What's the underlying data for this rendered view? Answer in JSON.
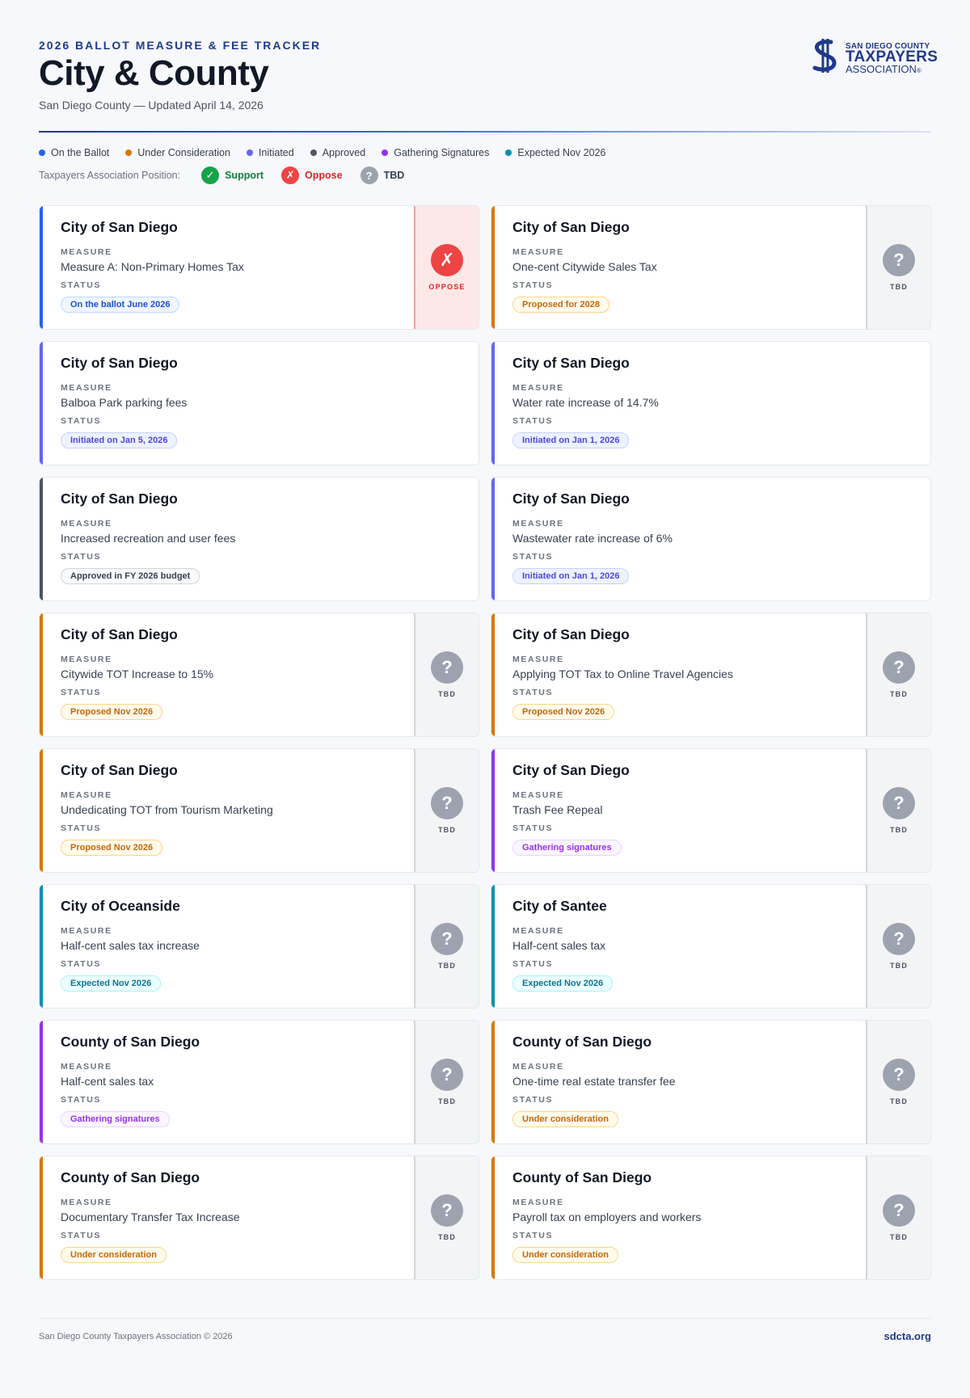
{
  "header": {
    "kicker": "2026 BALLOT MEASURE & FEE TRACKER",
    "title": "City & County",
    "subtitle": "San Diego County — Updated April 14, 2026"
  },
  "logo": {
    "line1": "SAN DIEGO COUNTY",
    "line2": "TAXPAYERS",
    "line3": "ASSOCIATION",
    "reg": "®"
  },
  "legend": [
    {
      "label": "On the Ballot",
      "color": "#2563eb"
    },
    {
      "label": "Under Consideration",
      "color": "#d97706"
    },
    {
      "label": "Initiated",
      "color": "#6366f1"
    },
    {
      "label": "Approved",
      "color": "#4b5563"
    },
    {
      "label": "Gathering Signatures",
      "color": "#9333ea"
    },
    {
      "label": "Expected Nov 2026",
      "color": "#0891b2"
    }
  ],
  "positions": {
    "label": "Taxpayers Association Position:",
    "items": [
      {
        "label": "Support",
        "glyph": "✓",
        "color": "#16a34a",
        "text_color": "#15803d",
        "icon": "check-icon"
      },
      {
        "label": "Oppose",
        "glyph": "✗",
        "color": "#ef4444",
        "text_color": "#dc2626",
        "icon": "x-icon"
      },
      {
        "label": "TBD",
        "glyph": "?",
        "color": "#9ca3af",
        "text_color": "#374151",
        "icon": "question-icon"
      }
    ]
  },
  "labels": {
    "measure": "MEASURE",
    "status": "STATUS"
  },
  "cards": [
    {
      "jurisdiction": "City of San Diego",
      "measure": "Measure A: Non-Primary Homes Tax",
      "status": "On the ballot June 2026",
      "category": "ballot",
      "position": "oppose",
      "position_label": "OPPOSE"
    },
    {
      "jurisdiction": "City of San Diego",
      "measure": "One-cent Citywide Sales Tax",
      "status": "Proposed for 2028",
      "category": "consideration",
      "position": "tbd",
      "position_label": "TBD"
    },
    {
      "jurisdiction": "City of San Diego",
      "measure": "Balboa Park parking fees",
      "status": "Initiated on Jan 5, 2026",
      "category": "initiated",
      "position": "none",
      "position_label": ""
    },
    {
      "jurisdiction": "City of San Diego",
      "measure": "Water rate increase of 14.7%",
      "status": "Initiated on Jan 1, 2026",
      "category": "initiated",
      "position": "none",
      "position_label": ""
    },
    {
      "jurisdiction": "City of San Diego",
      "measure": "Increased recreation and user fees",
      "status": "Approved in FY 2026 budget",
      "category": "approved",
      "position": "none",
      "position_label": ""
    },
    {
      "jurisdiction": "City of San Diego",
      "measure": "Wastewater rate increase of 6%",
      "status": "Initiated on Jan 1, 2026",
      "category": "initiated",
      "position": "none",
      "position_label": ""
    },
    {
      "jurisdiction": "City of San Diego",
      "measure": "Citywide TOT Increase to 15%",
      "status": "Proposed Nov 2026",
      "category": "consideration",
      "position": "tbd",
      "position_label": "TBD"
    },
    {
      "jurisdiction": "City of San Diego",
      "measure": "Applying TOT Tax to Online Travel Agencies",
      "status": "Proposed Nov 2026",
      "category": "consideration",
      "position": "tbd",
      "position_label": "TBD"
    },
    {
      "jurisdiction": "City of San Diego",
      "measure": "Undedicating TOT from Tourism Marketing",
      "status": "Proposed Nov 2026",
      "category": "consideration",
      "position": "tbd",
      "position_label": "TBD"
    },
    {
      "jurisdiction": "City of San Diego",
      "measure": "Trash Fee Repeal",
      "status": "Gathering signatures",
      "category": "signatures",
      "position": "tbd",
      "position_label": "TBD"
    },
    {
      "jurisdiction": "City of Oceanside",
      "measure": "Half-cent sales tax increase",
      "status": "Expected Nov 2026",
      "category": "expected",
      "position": "tbd",
      "position_label": "TBD"
    },
    {
      "jurisdiction": "City of Santee",
      "measure": "Half-cent sales tax",
      "status": "Expected Nov 2026",
      "category": "expected",
      "position": "tbd",
      "position_label": "TBD"
    },
    {
      "jurisdiction": "County of San Diego",
      "measure": "Half-cent sales tax",
      "status": "Gathering signatures",
      "category": "signatures",
      "position": "tbd",
      "position_label": "TBD"
    },
    {
      "jurisdiction": "County of San Diego",
      "measure": "One-time real estate transfer fee",
      "status": "Under consideration",
      "category": "consideration",
      "position": "tbd",
      "position_label": "TBD"
    },
    {
      "jurisdiction": "County of San Diego",
      "measure": "Documentary Transfer Tax Increase",
      "status": "Under consideration",
      "category": "consideration",
      "position": "tbd",
      "position_label": "TBD"
    },
    {
      "jurisdiction": "County of San Diego",
      "measure": "Payroll tax on employers and workers",
      "status": "Under consideration",
      "category": "consideration",
      "position": "tbd",
      "position_label": "TBD"
    }
  ],
  "category_colors": {
    "ballot": {
      "accent": "#2563eb",
      "text": "#1d4ed8",
      "bg": "#eff6ff",
      "border": "#bfdbfe"
    },
    "consideration": {
      "accent": "#d97706",
      "text": "#c2670a",
      "bg": "#fffbeb",
      "border": "#fcd58a"
    },
    "initiated": {
      "accent": "#6366f1",
      "text": "#4f46e5",
      "bg": "#eef2ff",
      "border": "#c7d2fe"
    },
    "approved": {
      "accent": "#4b5563",
      "text": "#374151",
      "bg": "#f9fafb",
      "border": "#d1d5db"
    },
    "signatures": {
      "accent": "#9333ea",
      "text": "#9333ea",
      "bg": "#faf5ff",
      "border": "#e9d5ff"
    },
    "expected": {
      "accent": "#0891b2",
      "text": "#0e7490",
      "bg": "#ecfeff",
      "border": "#a5f3fc"
    }
  },
  "footer": {
    "left": "San Diego County Taxpayers Association © 2026",
    "right": "sdcta.org"
  }
}
